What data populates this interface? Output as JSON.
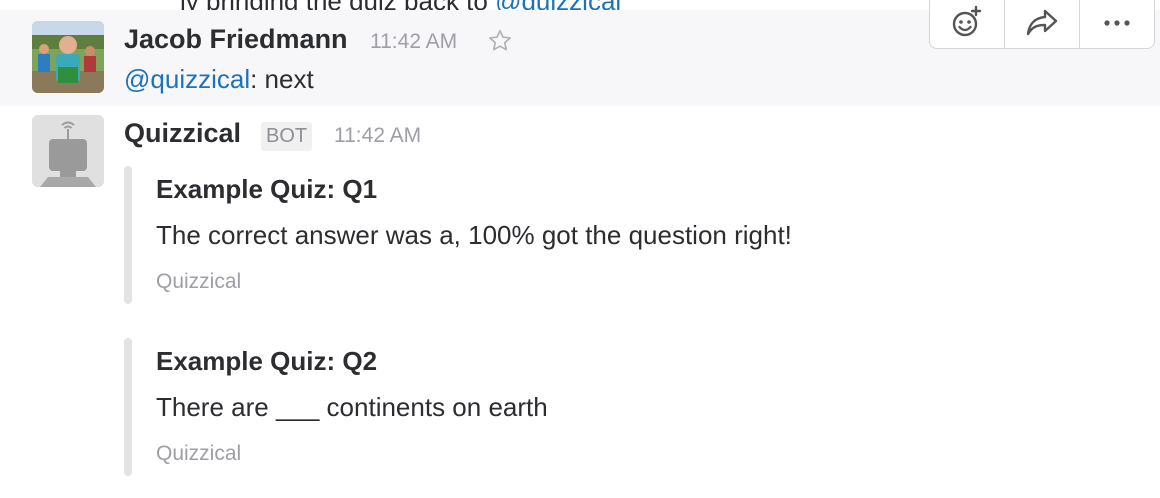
{
  "previous_message": {
    "text": "ly bringing the quiz back to ",
    "link": "@quizzical"
  },
  "messages": [
    {
      "sender": "Jacob Friedmann",
      "time": "11:42 AM",
      "mention": "@quizzical",
      "text": ": next"
    },
    {
      "sender": "Quizzical",
      "badge": "BOT",
      "time": "11:42 AM",
      "attachments": [
        {
          "title": "Example Quiz: Q1",
          "text": "The correct answer was a, 100% got the question right!",
          "footer": "Quizzical"
        },
        {
          "title": "Example Quiz: Q2",
          "text": "There are ___ continents on earth",
          "footer": "Quizzical"
        }
      ]
    }
  ],
  "message_actions": {
    "items": [
      "add-reaction-icon",
      "share-message-icon",
      "more-actions-icon"
    ]
  },
  "colors": {
    "link": "#1d72b8",
    "hover_background": "#f7f7f9",
    "attachment_bar": "#e3e3e3",
    "muted_text": "#9e9ea6"
  }
}
